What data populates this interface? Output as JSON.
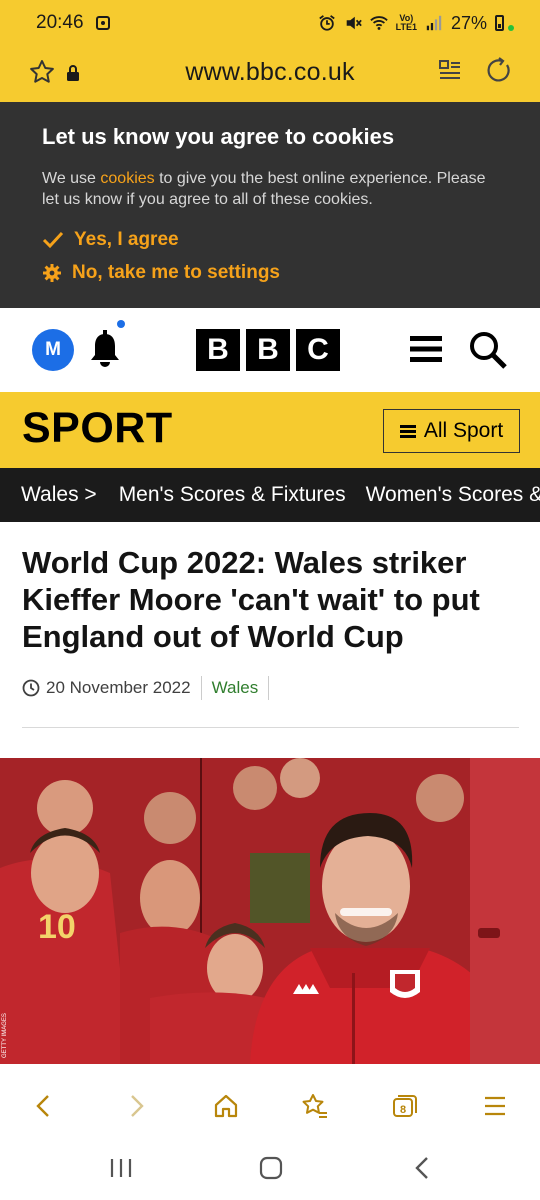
{
  "status_bar": {
    "time": "20:46",
    "lte_top": "Vo)",
    "lte_bottom": "LTE1",
    "battery": "27%"
  },
  "browser": {
    "url": "www.bbc.co.uk"
  },
  "cookie_banner": {
    "title": "Let us know you agree to cookies",
    "text_before": "We use ",
    "link": "cookies",
    "text_after": " to give you the best online experience. Please let us know if you agree to all of these cookies.",
    "agree_label": "Yes, I agree",
    "settings_label": "No, take me to settings"
  },
  "header": {
    "avatar_initial": "M",
    "logo_letters": [
      "B",
      "B",
      "C"
    ]
  },
  "sport_bar": {
    "title": "SPORT",
    "all_sport_label": "All Sport"
  },
  "nav_strip": {
    "items": [
      "Wales",
      "Men's Scores & Fixtures",
      "Women's Scores & Fixtures"
    ],
    "first_chevron": ">"
  },
  "article": {
    "headline": "World Cup 2022: Wales striker Kieffer Moore 'can't wait' to put England out of World Cup",
    "date": "20 November 2022",
    "topic": "Wales",
    "image_alt": "Kieffer Moore in front of a mural of Wales players celebrating",
    "image_credit": "GETTY IMAGES"
  },
  "colors": {
    "bbc_yellow": "#f6cb2f",
    "cookie_bg": "#323232",
    "cookie_accent": "#f6a21a",
    "nav_bg": "#1b1b1b",
    "topic_green": "#307e2e",
    "avatar_blue": "#1c6ee6",
    "browser_icon": "#b8860b"
  },
  "icons": {
    "star": "star-icon",
    "lock": "lock-icon",
    "reader": "reader-mode-icon",
    "reload": "reload-icon",
    "bell": "bell-icon",
    "menu": "menu-icon",
    "search": "search-icon",
    "clock": "clock-icon"
  },
  "browser_toolbar": {
    "tab_count": "8"
  }
}
